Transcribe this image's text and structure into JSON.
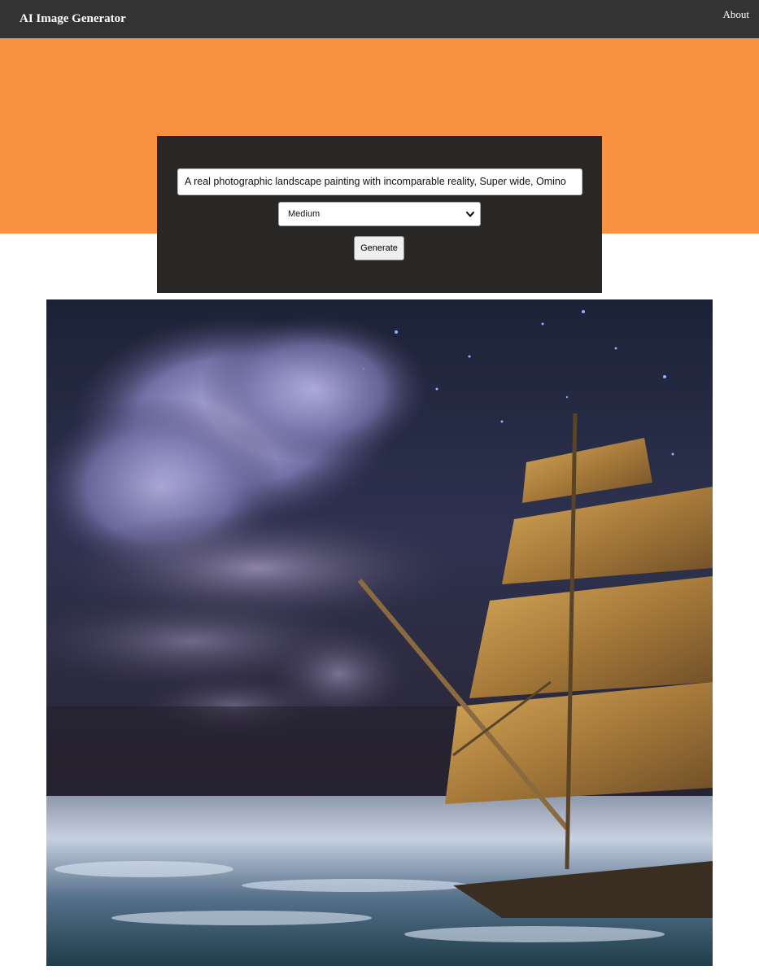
{
  "navbar": {
    "brand": "AI Image Generator",
    "about": "About"
  },
  "form": {
    "prompt_value": "A real photographic landscape painting with incomparable reality, Super wide, Omino",
    "size_selected": "Medium",
    "generate_label": "Generate"
  },
  "colors": {
    "navbar": "#333333",
    "hero": "#f89242",
    "panel": "#282726"
  },
  "result_image": {
    "subject": "painting of a tall sailing ship with golden sails beside storm clouds over a misty sea at night"
  },
  "icons": {
    "select_arrow": "chevron-down-icon"
  }
}
